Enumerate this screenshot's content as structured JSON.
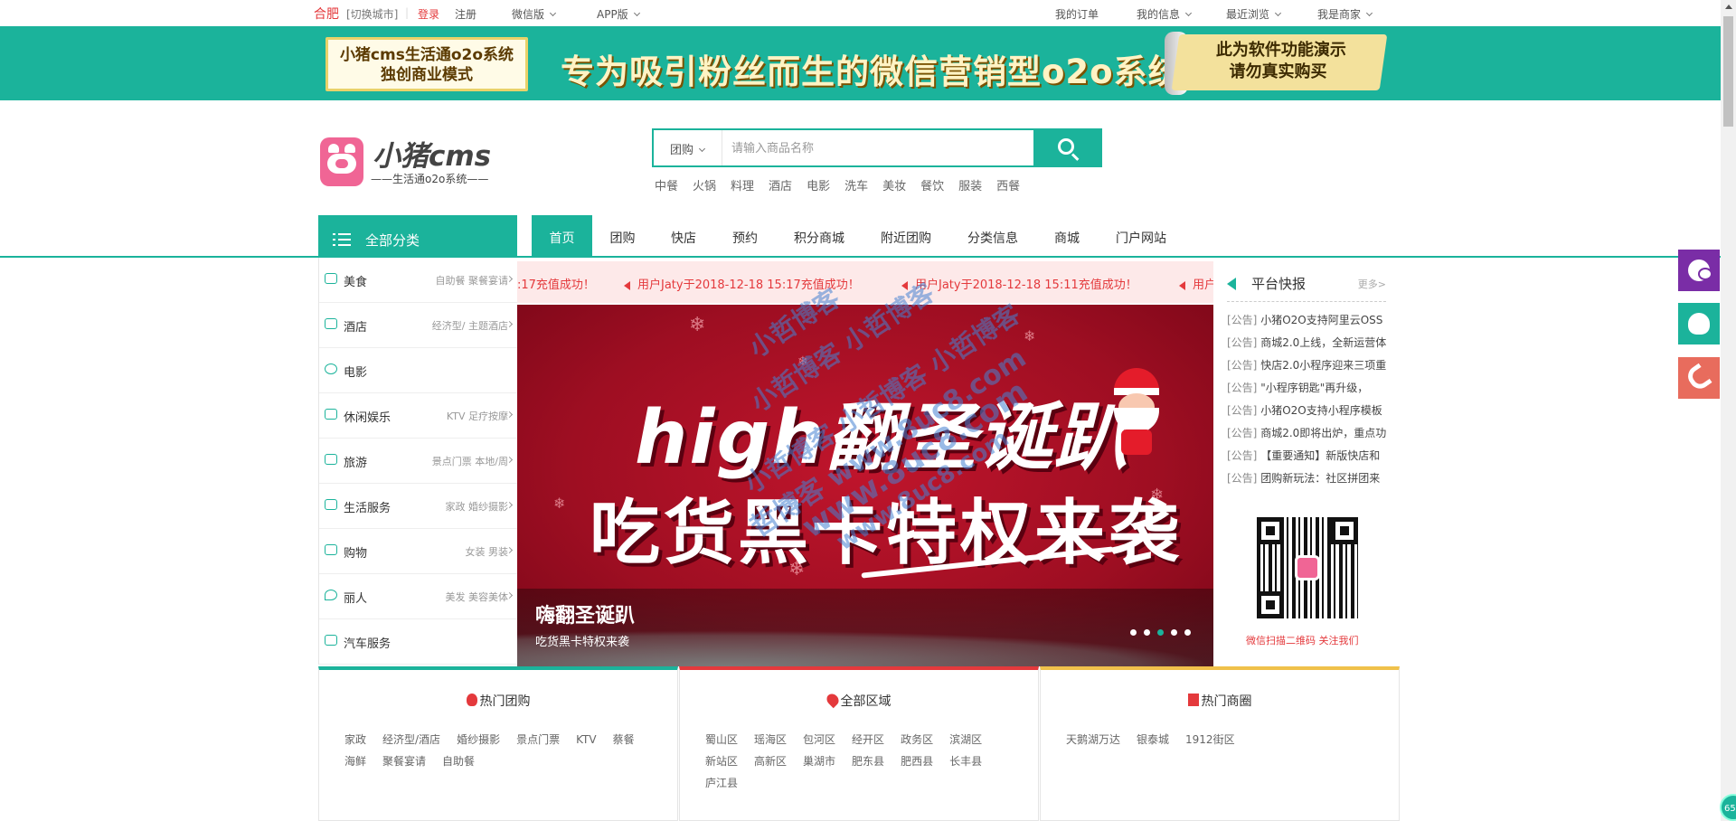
{
  "topbar": {
    "city": "合肥",
    "switch_city": "[切换城市]",
    "login": "登录",
    "register": "注册",
    "wechat": "微信版",
    "app": "APP版",
    "orders": "我的订单",
    "my_info": "我的信息",
    "recent": "最近浏览",
    "merchant": "我是商家"
  },
  "banner": {
    "left_line1": "小猪cms生活通o2o系统",
    "left_line2": "独创商业模式",
    "slogan": "专为吸引粉丝而生的微信营销型o2o系统",
    "right_line1": "此为软件功能演示",
    "right_line2": "请勿真实购买"
  },
  "logo": {
    "name": "小猪cms",
    "sub": "——生活通o2o系统——"
  },
  "search": {
    "type": "团购",
    "placeholder": "请输入商品名称",
    "hot_words": [
      "中餐",
      "火锅",
      "料理",
      "酒店",
      "电影",
      "洗车",
      "美妆",
      "餐饮",
      "服装",
      "西餐"
    ]
  },
  "category_head": "全部分类",
  "nav": [
    "首页",
    "团购",
    "快店",
    "预约",
    "积分商城",
    "附近团购",
    "分类信息",
    "商城",
    "门户网站"
  ],
  "categories": [
    {
      "name": "美食",
      "subs": "自助餐   聚餐宴请"
    },
    {
      "name": "酒店",
      "subs": "经济型/   主题酒店"
    },
    {
      "name": "电影",
      "subs": ""
    },
    {
      "name": "休闲娱乐",
      "subs": "KTV   足疗按摩"
    },
    {
      "name": "旅游",
      "subs": "景点门票   本地/周"
    },
    {
      "name": "生活服务",
      "subs": "家政   婚纱摄影"
    },
    {
      "name": "购物",
      "subs": "女装   男装"
    },
    {
      "name": "丽人",
      "subs": "美发   美容美体"
    },
    {
      "name": "汽车服务",
      "subs": ""
    }
  ],
  "ticker": [
    ":17充值成功！",
    "用户Jaty于2018-12-18 15:17充值成功！",
    "用户Jaty于2018-12-18 15:11充值成功！",
    "用户"
  ],
  "slide": {
    "headline1": "high翻圣诞趴",
    "headline2": "吃货黑卡特权来袭",
    "caption_title": "嗨翻圣诞趴",
    "caption_sub": "吃货黑卡特权来袭",
    "dots_total": 5,
    "dots_active": 3
  },
  "watermark": [
    "小哲博客",
    "小哲博客 小哲博客",
    "小哲博客 小哲博客 小哲博客",
    "哲博客 www.8uc8.com",
    "www.8uc8.com",
    "www.8uc8.com"
  ],
  "news": {
    "title": "平台快报",
    "more": "更多>",
    "items": [
      {
        "tag": "[公告]",
        "text": "小猪O2O支持阿里云OSS"
      },
      {
        "tag": "[公告]",
        "text": "商城2.0上线，全新运营体"
      },
      {
        "tag": "[公告]",
        "text": "快店2.0小程序迎来三项重"
      },
      {
        "tag": "[公告]",
        "text": "\"小程序钥匙\"再升级，"
      },
      {
        "tag": "[公告]",
        "text": "小猪O2O支持小程序模板"
      },
      {
        "tag": "[公告]",
        "text": "商城2.0即将出炉，重点功"
      },
      {
        "tag": "[公告]",
        "text": "【重要通知】新版快店和"
      },
      {
        "tag": "[公告]",
        "text": "团购新玩法：社区拼团来"
      }
    ],
    "qr_caption": "微信扫描二维码 关注我们"
  },
  "panels": [
    {
      "title": "热门团购",
      "color": "#1bb39b",
      "links": [
        "家政",
        "经济型/酒店",
        "婚纱摄影",
        "景点门票",
        "KTV",
        "蔡餐",
        "海鲜",
        "聚餐宴请",
        "自助餐"
      ]
    },
    {
      "title": "全部区域",
      "color": "#e4393c",
      "links": [
        "蜀山区",
        "瑶海区",
        "包河区",
        "经开区",
        "政务区",
        "滨湖区",
        "新站区",
        "高新区",
        "巢湖市",
        "肥东县",
        "肥西县",
        "长丰县",
        "庐江县"
      ]
    },
    {
      "title": "热门商圈",
      "color": "#f0c14b",
      "links": [
        "天鹅湖万达",
        "银泰城",
        "1912街区"
      ]
    }
  ],
  "badge": "65"
}
